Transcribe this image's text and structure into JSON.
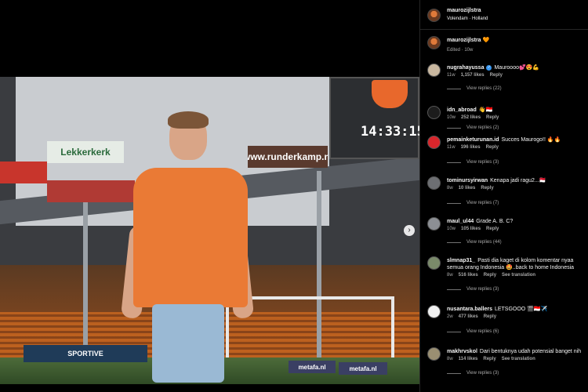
{
  "photo": {
    "scoreboard_time": "14:33:15",
    "ads": [
      "Lekkerkerk",
      "www.runderkamp.nl",
      "metafa.nl",
      "metafa.nl",
      "SPORTIVE"
    ],
    "next_icon": "chevron-right-icon",
    "next_symbol": "›"
  },
  "post": {
    "username": "maurozijlstra",
    "location": "Volendam · Holland",
    "caption_username": "maurozijlstra",
    "caption_text": "🧡",
    "caption_meta": "Edited · 10w"
  },
  "colors": {
    "panel_bg": "#000000",
    "muted_text": "#a8a8a8",
    "verified_blue": "#3897f0",
    "jersey_orange": "#ea7a35"
  },
  "comments": [
    {
      "username": "nugrahayussa",
      "verified": true,
      "text": "Mauroooo💕😍💪",
      "time": "11w",
      "likes": "1,157 likes",
      "reply": "Reply",
      "see_translation": "",
      "view_replies": "View replies (22)",
      "avatar_color": "#c9b8a0"
    },
    {
      "username": "idn_abroad",
      "verified": false,
      "text": "👋🇮🇩",
      "time": "10w",
      "likes": "252 likes",
      "reply": "Reply",
      "see_translation": "",
      "view_replies": "View replies (2)",
      "avatar_color": "#1c1c1c"
    },
    {
      "username": "pemainketurunan.id",
      "verified": false,
      "text": "Succes Maurogo!! 🔥🔥",
      "time": "11w",
      "likes": "196 likes",
      "reply": "Reply",
      "see_translation": "",
      "view_replies": "View replies (3)",
      "avatar_color": "#d8262c"
    },
    {
      "username": "tominursyirwan",
      "verified": false,
      "text": "Kenapa jadi ragu2...🇲🇨",
      "time": "8w",
      "likes": "10 likes",
      "reply": "Reply",
      "see_translation": "",
      "view_replies": "View replies (7)",
      "avatar_color": "#6d6f73"
    },
    {
      "username": "maul_ul44",
      "verified": false,
      "text": "Grade A. B. C?",
      "time": "10w",
      "likes": "105 likes",
      "reply": "Reply",
      "see_translation": "",
      "view_replies": "View replies (44)",
      "avatar_color": "#8c8f94"
    },
    {
      "username": "slmnap31_",
      "verified": false,
      "text": "Pasti dia kaget di kolom komentar nyaa semua orang Indonesia 🤩..back to home Indonesia please 🇮🇩",
      "time": "8w",
      "likes": "516 likes",
      "reply": "Reply",
      "see_translation": "See translation",
      "view_replies": "View replies (3)",
      "avatar_color": "#7a8a6a"
    },
    {
      "username": "nusantara.ballers",
      "verified": false,
      "text": "LETSGOOO 🎬🇮🇩✈️",
      "time": "2w",
      "likes": "477 likes",
      "reply": "Reply",
      "see_translation": "",
      "view_replies": "View replies (6)",
      "avatar_color": "#f0f0f0"
    },
    {
      "username": "makhrvskol",
      "verified": false,
      "text": "Dari bentuknya udah potensial banget nih",
      "time": "8w",
      "likes": "114 likes",
      "reply": "Reply",
      "see_translation": "See translation",
      "view_replies": "View replies (3)",
      "avatar_color": "#9a8f72"
    }
  ]
}
